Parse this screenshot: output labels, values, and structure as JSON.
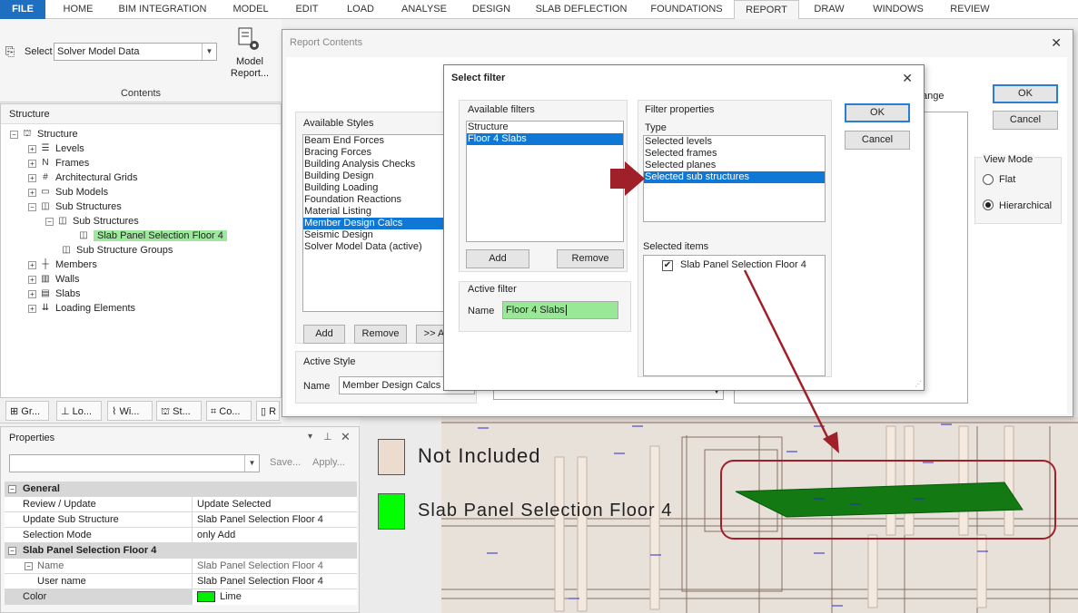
{
  "ribbon": {
    "tabs": [
      "FILE",
      "HOME",
      "BIM INTEGRATION",
      "MODEL",
      "EDIT",
      "LOAD",
      "ANALYSE",
      "DESIGN",
      "SLAB DEFLECTION",
      "FOUNDATIONS",
      "REPORT",
      "DRAW",
      "WINDOWS",
      "REVIEW"
    ],
    "select_label": "Select",
    "select_value": "Solver Model Data",
    "model_report_label": "Model Report...",
    "group_label": "Contents"
  },
  "structure": {
    "title": "Structure",
    "items": [
      {
        "label": "Structure"
      },
      {
        "label": "Levels"
      },
      {
        "label": "Frames"
      },
      {
        "label": "Architectural Grids"
      },
      {
        "label": "Sub Models"
      },
      {
        "label": "Sub Structures"
      },
      {
        "label": "Sub Structures"
      },
      {
        "label": "Slab Panel Selection Floor 4"
      },
      {
        "label": "Sub Structure Groups"
      },
      {
        "label": "Members"
      },
      {
        "label": "Walls"
      },
      {
        "label": "Slabs"
      },
      {
        "label": "Loading Elements"
      }
    ]
  },
  "bottom_tabs": [
    "Gr...",
    "Lo...",
    "Wi...",
    "St...",
    "Co...",
    "R"
  ],
  "properties": {
    "title": "Properties",
    "save_label": "Save...",
    "apply_label": "Apply...",
    "general_header": "General",
    "slab_header": "Slab Panel Selection Floor 4",
    "rows": [
      {
        "key": "Review / Update",
        "value": "Update Selected"
      },
      {
        "key": "Update Sub Structure",
        "value": "Slab Panel Selection Floor 4"
      },
      {
        "key": "Selection Mode",
        "value": "only Add"
      }
    ],
    "slab_rows": [
      {
        "key": "Name",
        "value": "Slab Panel Selection Floor 4"
      },
      {
        "key": "User name",
        "value": "Slab Panel Selection Floor 4"
      },
      {
        "key": "Color",
        "value": "Lime"
      }
    ],
    "color_hex": "#00ee00"
  },
  "report_contents": {
    "title": "Report Contents",
    "ok_label": "OK",
    "cancel_label": "Cancel",
    "available_styles_label": "Available Styles",
    "styles": [
      "Beam End Forces",
      "Bracing Forces",
      "Building Analysis Checks",
      "Building Design",
      "Building Loading",
      "Foundation Reactions",
      "Material Listing",
      "Member Design Calcs",
      "Seismic Design",
      "Solver Model Data (active)"
    ],
    "selected_style_index": 7,
    "add_label": "Add",
    "remove_label": "Remove",
    "more_label": ">> A",
    "active_style_label": "Active Style",
    "name_label": "Name",
    "active_style_name": "Member Design Calcs",
    "view_mode_label": "View Mode",
    "flat_label": "Flat",
    "hierarchical_label": "Hierarchical",
    "partial_range_label": "ange"
  },
  "select_filter": {
    "title": "Select filter",
    "available_filters_label": "Available filters",
    "filters": [
      "Structure",
      "Floor 4 Slabs"
    ],
    "selected_filter_index": 1,
    "add_label": "Add",
    "remove_label": "Remove",
    "active_filter_label": "Active filter",
    "name_label": "Name",
    "active_filter_name": "Floor 4 Slabs",
    "filter_properties_label": "Filter properties",
    "type_label": "Type",
    "types": [
      "Selected levels",
      "Selected frames",
      "Selected planes",
      "Selected sub structures"
    ],
    "selected_type_index": 3,
    "selected_items_label": "Selected items",
    "selected_items": [
      "Slab Panel Selection Floor 4"
    ],
    "ok_label": "OK",
    "cancel_label": "Cancel"
  },
  "legend": {
    "not_included": "Not Included",
    "slab_selection": "Slab Panel Selection Floor 4",
    "not_included_color": "#ecdccf",
    "slab_color": "#00ff00"
  },
  "accent": {
    "selection_blue": "#0f78d7",
    "arrow_red": "#a0202a"
  }
}
